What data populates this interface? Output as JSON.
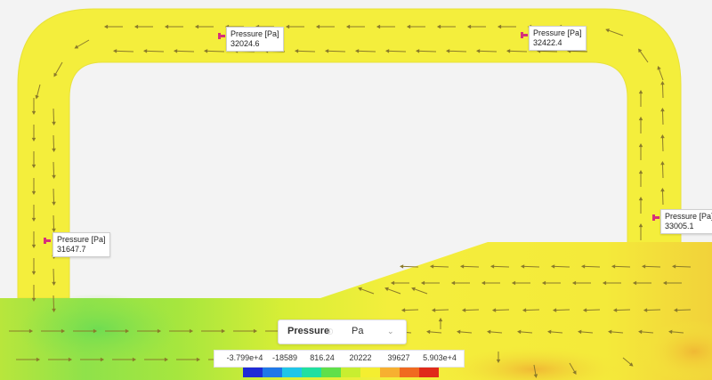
{
  "probes": [
    {
      "label": "Pressure [Pa]",
      "value": "31647.7"
    },
    {
      "label": "Pressure [Pa]",
      "value": "32024.6"
    },
    {
      "label": "Pressure [Pa]",
      "value": "32422.4"
    },
    {
      "label": "Pressure [Pa]",
      "value": "33005.1"
    }
  ],
  "legend": {
    "field": "Pressure",
    "info_icon": "info-icon",
    "unit": "Pa",
    "ticks": [
      "-3.799e+4",
      "-18589",
      "816.24",
      "20222",
      "39627",
      "5.903e+4"
    ],
    "min": -37990,
    "max": 59030,
    "colors": [
      "#1f2bd6",
      "#1f78e8",
      "#20c6e8",
      "#20e0a0",
      "#5fe04a",
      "#c8ee30",
      "#f4ee30",
      "#f7b030",
      "#f06a20",
      "#e02a1a"
    ]
  },
  "colors": {
    "pipe": "#f4ee3c",
    "pipe_dark": "#e6e034",
    "background": "#f3f3f3",
    "flow_green": "#8fe24a",
    "flow_warm": "#f2c93a",
    "arrow": "#8a7a2a"
  }
}
